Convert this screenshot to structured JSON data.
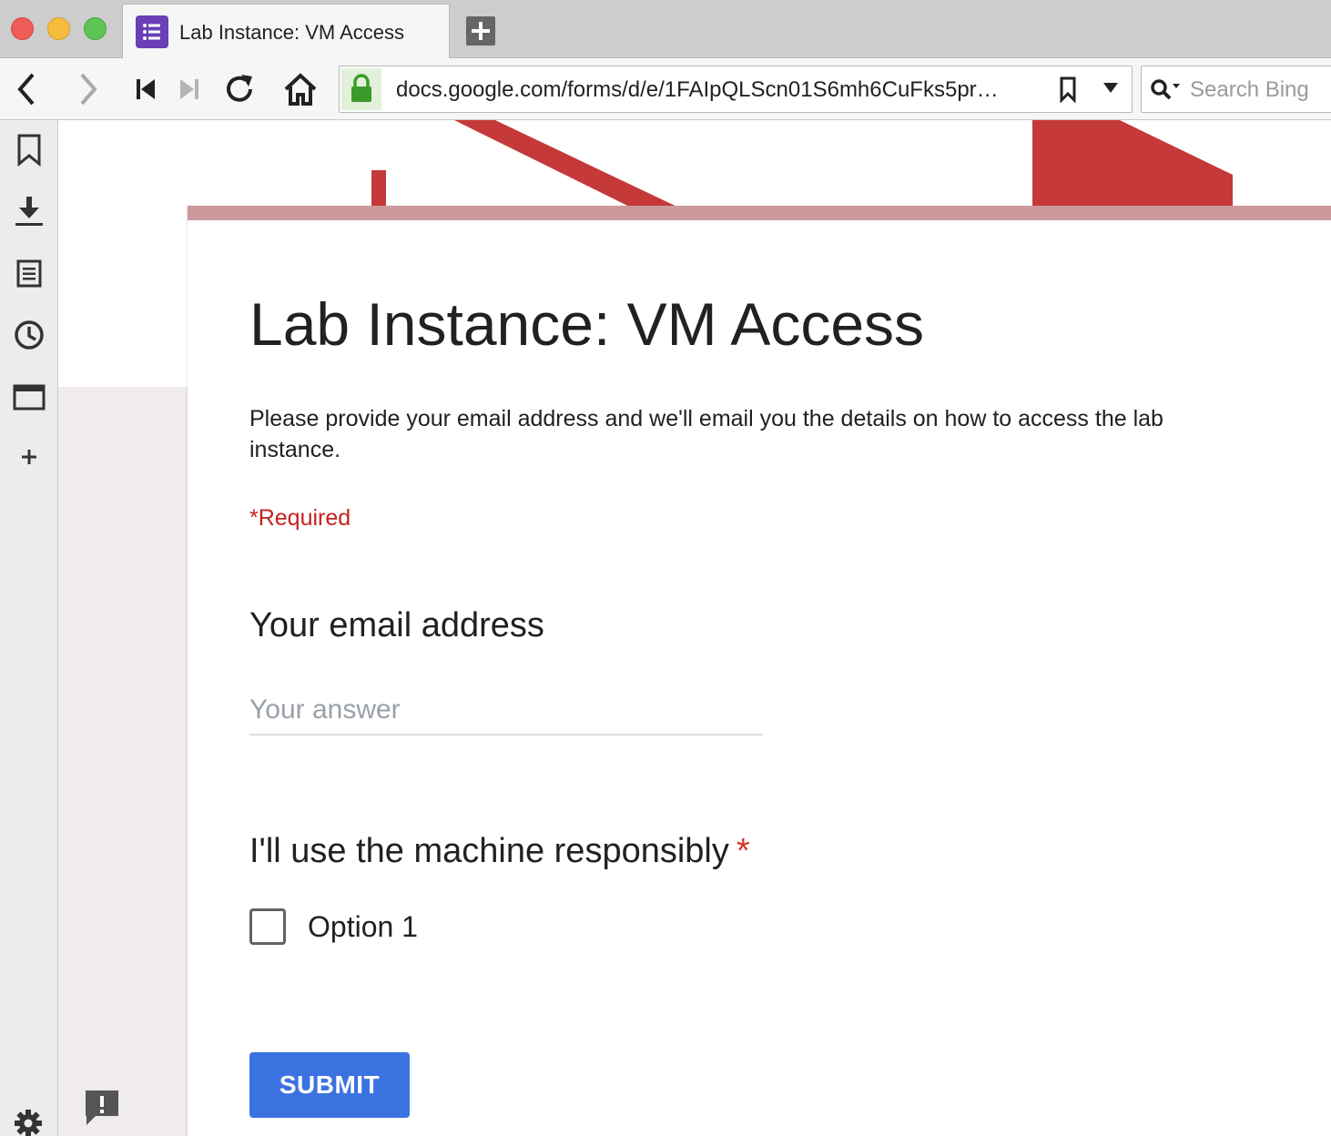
{
  "browser": {
    "tab": {
      "title": "Lab Instance: VM Access",
      "favicon": "google-forms-icon"
    },
    "new_tab_icon": "plus-icon",
    "nav": {
      "back_icon": "chevron-left-icon",
      "forward_icon": "chevron-right-icon",
      "rewind_icon": "skip-back-icon",
      "fastforward_icon": "skip-forward-icon",
      "reload_icon": "reload-icon",
      "home_icon": "home-icon"
    },
    "url": {
      "text": "docs.google.com/forms/d/e/1FAIpQLScn01S6mh6CuFks5pr…",
      "lock_icon": "lock-icon",
      "bookmark_icon": "bookmark-icon",
      "dropdown_icon": "triangle-down-icon"
    },
    "search": {
      "placeholder": "Search Bing",
      "icon": "search-icon"
    },
    "sidebar": [
      {
        "icon": "bookmark-icon"
      },
      {
        "icon": "download-icon"
      },
      {
        "icon": "notes-icon"
      },
      {
        "icon": "history-icon"
      },
      {
        "icon": "window-icon"
      },
      {
        "icon": "plus-icon"
      }
    ],
    "sidebar_bottom": {
      "icon": "gear-icon"
    }
  },
  "form": {
    "title": "Lab Instance: VM Access",
    "description": "Please provide your email address and we'll email you the details on how to access the lab instance.",
    "required_note": "*Required",
    "questions": [
      {
        "title": "Your email address",
        "placeholder": "Your answer",
        "value": ""
      },
      {
        "title": "I'll use the machine responsibly",
        "required_mark": "*",
        "options": [
          "Option 1"
        ],
        "checked": false
      }
    ],
    "submit_label": "SUBMIT",
    "feedback_icon": "feedback-icon"
  },
  "colors": {
    "accent_bar": "#cc999d",
    "required_red": "#c5221f",
    "submit_blue": "#3a73e0",
    "forms_purple": "#6a3fb8",
    "banner_red": "#c53a38"
  }
}
